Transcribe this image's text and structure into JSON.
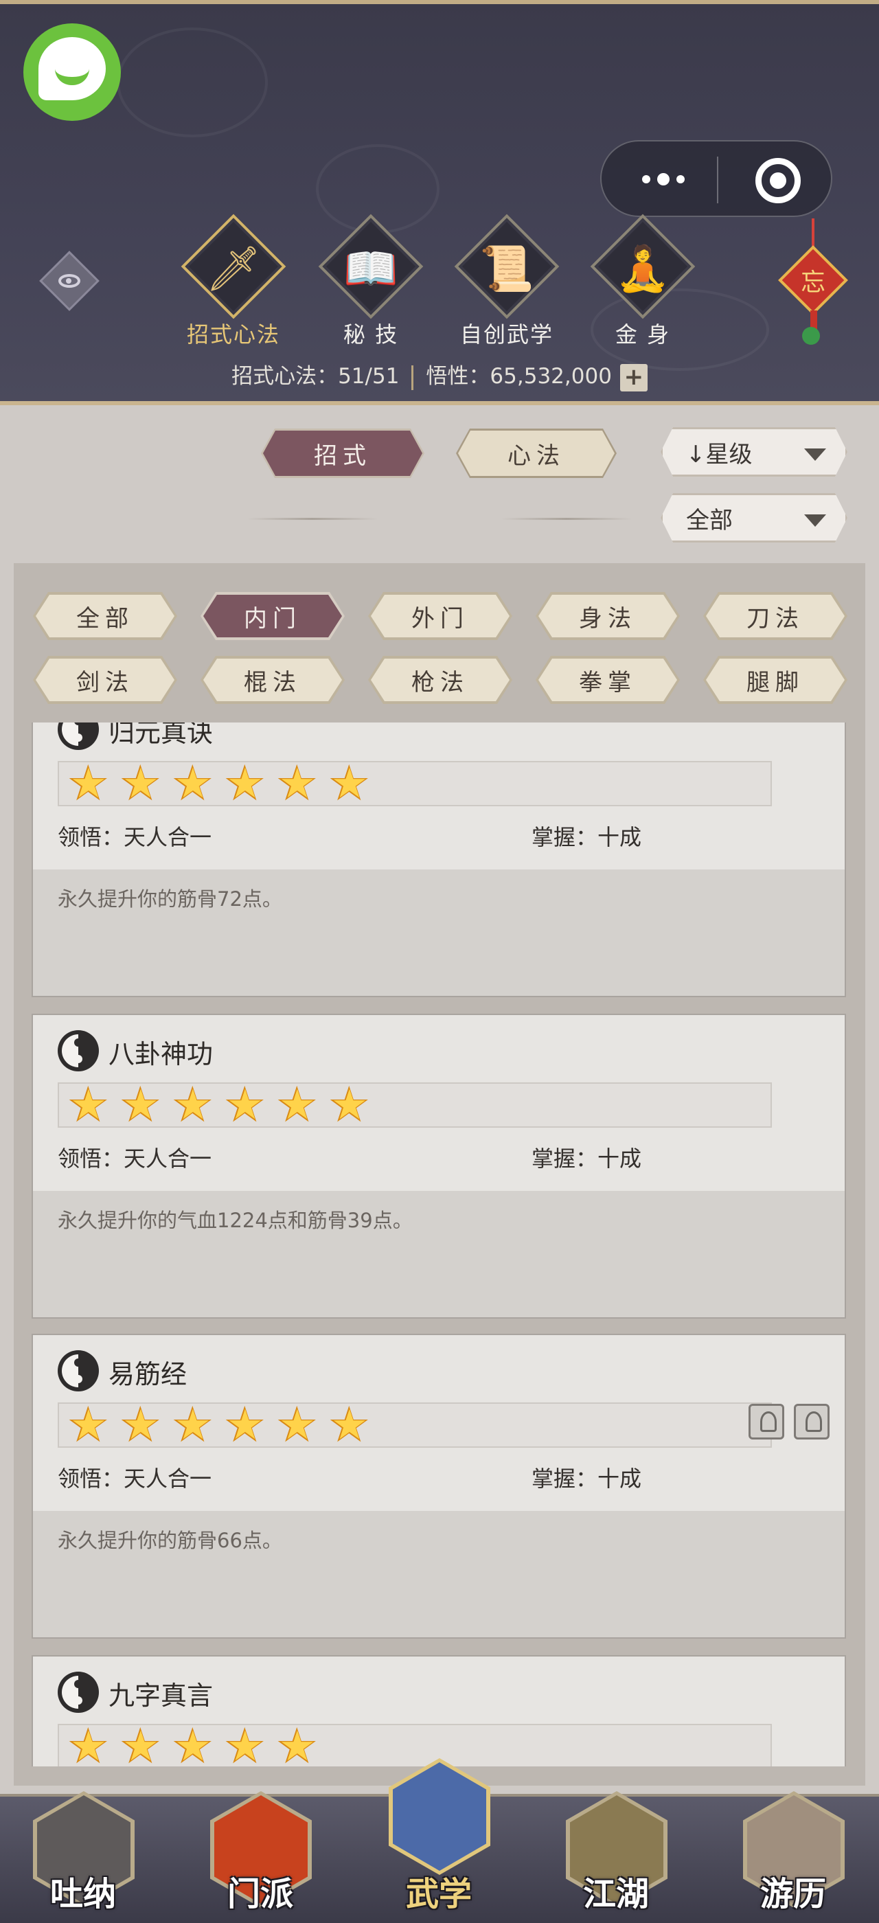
{
  "top_nav": [
    {
      "glyph": "🗡",
      "label": "招式心法",
      "icon": "sword-icon"
    },
    {
      "glyph": "📖",
      "label": "秘 技",
      "icon": "book-icon"
    },
    {
      "glyph": "📜",
      "label": "自创武学",
      "icon": "scroll-icon"
    },
    {
      "glyph": "🧘",
      "label": "金 身",
      "icon": "meditation-icon"
    }
  ],
  "knot_char": "忘",
  "stats": {
    "progress": "招式心法：51/51",
    "insight": "悟性：65,532,000",
    "plus": "+"
  },
  "tabs": {
    "moves": "招式",
    "methods": "心法"
  },
  "sort": {
    "label": "↓星级",
    "filter": "全部"
  },
  "filters": [
    "全部",
    "内门",
    "外门",
    "身法",
    "刀法",
    "剑法",
    "棍法",
    "枪法",
    "拳掌",
    "腿脚"
  ],
  "cards": [
    {
      "name": "归元真诀",
      "stars": 6,
      "lingwu": "领悟：天人合一",
      "zhangwo": "掌握：十成",
      "desc": "永久提升你的筋骨72点。",
      "tags": 0
    },
    {
      "name": "八卦神功",
      "stars": 6,
      "lingwu": "领悟：天人合一",
      "zhangwo": "掌握：十成",
      "desc": "永久提升你的气血1224点和筋骨39点。",
      "tags": 0
    },
    {
      "name": "易筋经",
      "stars": 6,
      "lingwu": "领悟：天人合一",
      "zhangwo": "掌握：十成",
      "desc": "永久提升你的筋骨66点。",
      "tags": 2
    },
    {
      "name": "九字真言",
      "stars": 5,
      "lingwu": "",
      "zhangwo": "",
      "desc": "",
      "tags": 0
    }
  ],
  "bottom_nav": [
    {
      "label": "吐纳",
      "color": "#5e5a5a"
    },
    {
      "label": "门派",
      "color": "#c8421e"
    },
    {
      "label": "武学",
      "color": "#4c6aa8"
    },
    {
      "label": "江湖",
      "color": "#8a7a52"
    },
    {
      "label": "游历",
      "color": "#a08f7e"
    }
  ],
  "colors": {
    "accent": "#7c5660",
    "gold": "#e2c27a",
    "star": "#ffd34a"
  }
}
